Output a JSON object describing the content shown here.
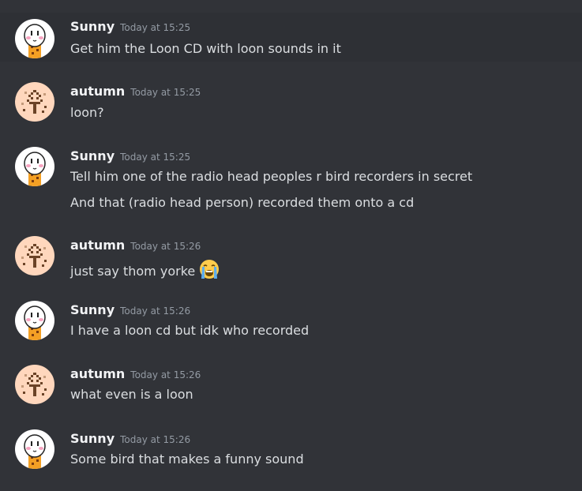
{
  "messages": [
    {
      "author": "Sunny",
      "timestamp": "Today at 15:25",
      "lines": [
        "Get him the Loon CD with loon sounds in it"
      ]
    },
    {
      "author": "autumn",
      "timestamp": "Today at 15:25",
      "lines": [
        "loon?"
      ]
    },
    {
      "author": "Sunny",
      "timestamp": "Today at 15:25",
      "lines": [
        "Tell him one of the radio head peoples r bird recorders in secret",
        "And that (radio head person) recorded them onto a cd"
      ]
    },
    {
      "author": "autumn",
      "timestamp": "Today at 15:26",
      "lines": [
        "just say thom yorke"
      ],
      "emoji": "loudly-crying-face"
    },
    {
      "author": "Sunny",
      "timestamp": "Today at 15:26",
      "lines": [
        "I have a loon cd but idk who recorded"
      ]
    },
    {
      "author": "autumn",
      "timestamp": "Today at 15:26",
      "lines": [
        "what even is a loon"
      ]
    },
    {
      "author": "Sunny",
      "timestamp": "Today at 15:26",
      "lines": [
        "Some bird that makes a funny sound"
      ]
    }
  ],
  "colors": {
    "background": "#313338",
    "hover_background": "#2e3035",
    "username": "#f2f3f5",
    "timestamp": "#949ba4",
    "message_text": "#dbdee1",
    "autumn_avatar_bg": "#ffd7bd"
  }
}
